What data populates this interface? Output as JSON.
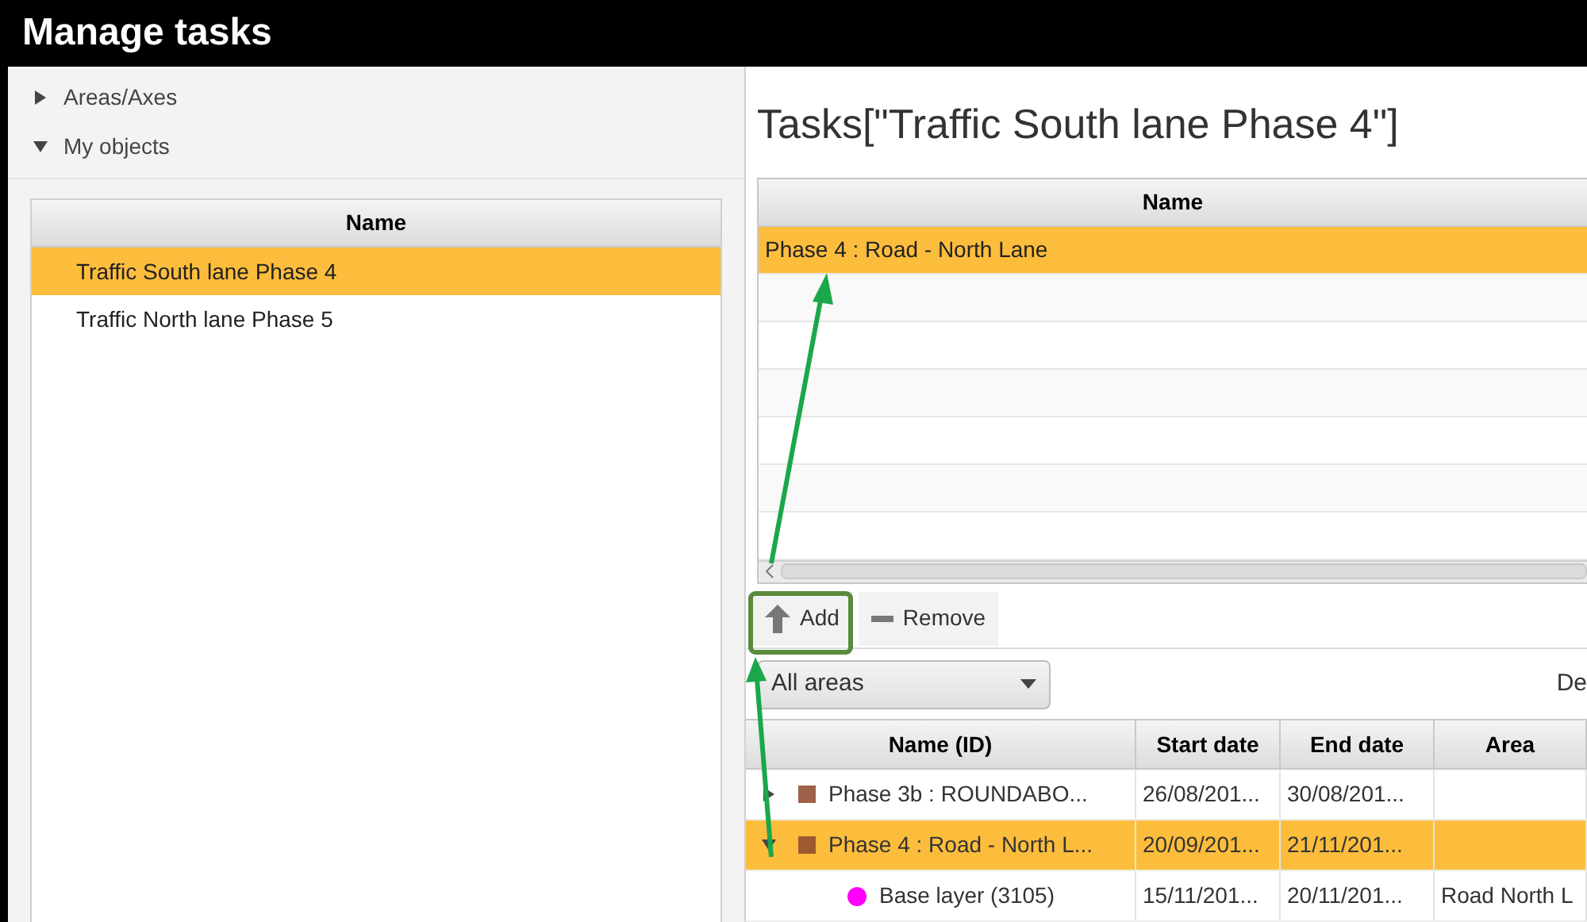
{
  "window": {
    "title": "Manage tasks"
  },
  "sidebar": {
    "sections": [
      {
        "label": "Areas/Axes",
        "expanded": false
      },
      {
        "label": "My objects",
        "expanded": true
      }
    ],
    "objects_table": {
      "columns": [
        "Name"
      ],
      "rows": [
        {
          "name": "Traffic South lane Phase 4",
          "selected": true
        },
        {
          "name": "Traffic North lane Phase 5",
          "selected": false
        }
      ]
    }
  },
  "tasks": {
    "title": "Tasks[\"Traffic South lane Phase 4\"]",
    "table": {
      "columns": [
        "Name"
      ],
      "rows": [
        {
          "name": "Phase 4 : Road - North Lane",
          "selected": true
        }
      ]
    },
    "toolbar": [
      {
        "kind": "add",
        "label": "Add"
      },
      {
        "kind": "remove",
        "label": "Remove"
      }
    ]
  },
  "filter": {
    "area_dropdown": "All areas",
    "column_2": "De"
  },
  "tree_table": {
    "columns": [
      "Name (ID)",
      "Start date",
      "End date",
      "Area"
    ],
    "rows": [
      {
        "kind": "task",
        "color": "#a0614a",
        "name": "Phase 3b : ROUNDABO...",
        "start": "26/08/201...",
        "end": "30/08/201...",
        "expanded": false,
        "selected": false
      },
      {
        "kind": "task",
        "color": "#9c5a2e",
        "name": "Phase 4 : Road - North L...",
        "start": "20/09/201...",
        "end": "21/11/201...",
        "expanded": true,
        "selected": true,
        "children": [
          {
            "kind": "layer",
            "color": "#ff00ff",
            "name": "Base layer (3105)",
            "start": "15/11/201...",
            "end": "20/11/201...",
            "area": "Road North L",
            "selected": false
          }
        ]
      }
    ]
  }
}
